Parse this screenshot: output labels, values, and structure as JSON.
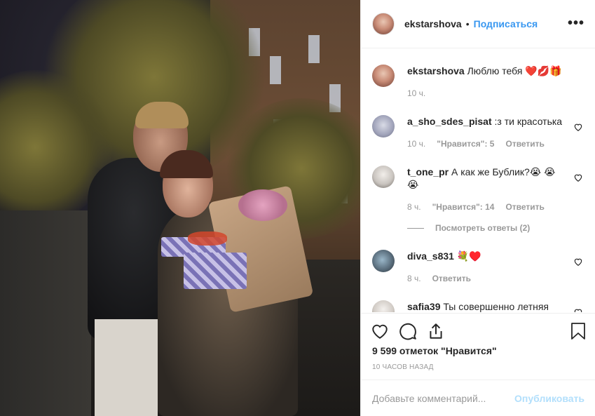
{
  "post": {
    "username": "ekstarshova",
    "dot": "•",
    "follow": "Подписаться",
    "more": "•••"
  },
  "comments": [
    {
      "user": "ekstarshova",
      "text": "Люблю тебя ❤️💋🎁",
      "time": "10 ч.",
      "likes": "",
      "reply": ""
    },
    {
      "user": "a_sho_sdes_pisat",
      "text": ":з ти красотька",
      "time": "10 ч.",
      "likes": "\"Нравится\": 5",
      "reply": "Ответить"
    },
    {
      "user": "t_one_pr",
      "text": "А как же Бублик?😭 😭 😭",
      "time": "8 ч.",
      "likes": "\"Нравится\": 14",
      "reply": "Ответить",
      "view_replies": "Посмотреть ответы (2)"
    },
    {
      "user": "diva_s831",
      "text": "💐♥️",
      "time": "8 ч.",
      "likes": "",
      "reply": "Ответить"
    },
    {
      "user": "safia39",
      "text": "Ты совершенно летняя хоть ?",
      "time": "",
      "likes": "",
      "reply": ""
    }
  ],
  "likes_count": "9 599 отметок \"Нравится\"",
  "timestamp": "10 ЧАСОВ НАЗАД",
  "add_comment": {
    "placeholder": "Добавьте комментарий...",
    "publish": "Опубликовать"
  },
  "icons": {
    "like": "heart-icon",
    "comment": "comment-icon",
    "share": "share-icon",
    "save": "bookmark-icon",
    "comment_like": "small-heart-icon"
  },
  "colors": {
    "link": "#3897f0",
    "muted": "#999999",
    "publish_disabled": "#b2dffc",
    "border": "#efefef"
  }
}
